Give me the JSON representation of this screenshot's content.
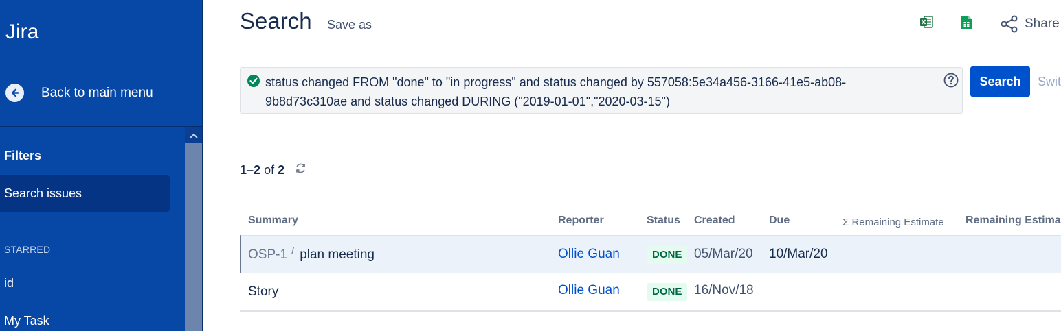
{
  "sidebar": {
    "brand": "Jira",
    "back_label": "Back to main menu",
    "heading": "Filters",
    "active_item": "Search issues",
    "section_label": "STARRED",
    "items": [
      "id",
      "My Task"
    ]
  },
  "header": {
    "title": "Search",
    "save_as": "Save as",
    "share_label": "Share"
  },
  "query": {
    "text": "status changed FROM \"done\" to \"in progress\" and status changed by 557058:5e34a456-3166-41e5-ab08-9b8d73c310ae and status changed DURING (\"2019-01-01\",\"2020-03-15\")",
    "search_label": "Search",
    "switch_label": "Swit"
  },
  "results": {
    "range_start": "1",
    "range_end": "2",
    "of_word": "of",
    "total": "2"
  },
  "table": {
    "columns": [
      "Summary",
      "Reporter",
      "Status",
      "Created",
      "Due",
      "Σ Remaining Estimate",
      "Remaining Estimate"
    ],
    "rows": [
      {
        "key": "OSP-1",
        "separator": "/",
        "summary": "plan meeting",
        "reporter": "Ollie Guan",
        "status": "DONE",
        "created": "05/Mar/20",
        "due": "10/Mar/20"
      },
      {
        "key": "",
        "separator": "",
        "summary": "Story",
        "reporter": "Ollie Guan",
        "status": "DONE",
        "created": "16/Nov/18",
        "due": ""
      }
    ]
  },
  "colors": {
    "sidebar_bg": "#0747a6",
    "primary": "#0052cc",
    "done_bg": "#e3fcef",
    "done_text": "#006644",
    "success": "#00875a"
  }
}
